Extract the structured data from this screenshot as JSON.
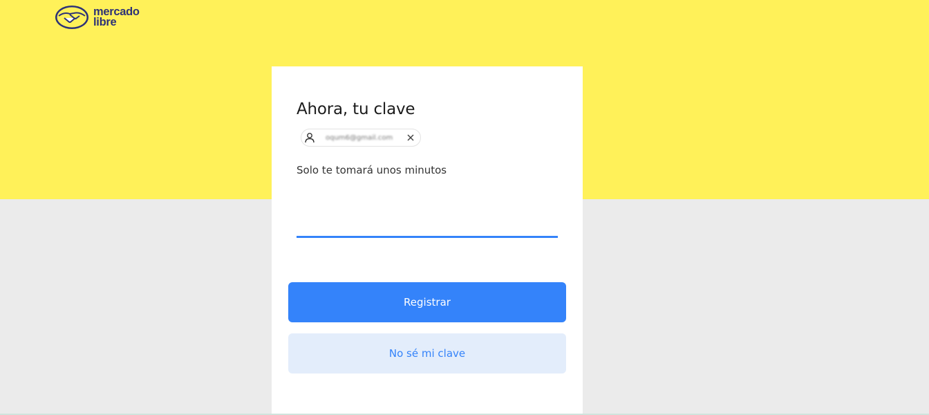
{
  "brand": {
    "line1": "mercado",
    "line2": "libre",
    "logo_icon": "handshake-icon",
    "accent_yellow": "#fff159",
    "accent_blue": "#3483fa"
  },
  "login": {
    "title": "Ahora, tu clave",
    "account_email": "oqum6@gmail.com",
    "subtitle": "Solo te tomará unos minutos",
    "password_value": "",
    "submit_label": "Registrar",
    "forgot_label": "No sé mi clave"
  }
}
